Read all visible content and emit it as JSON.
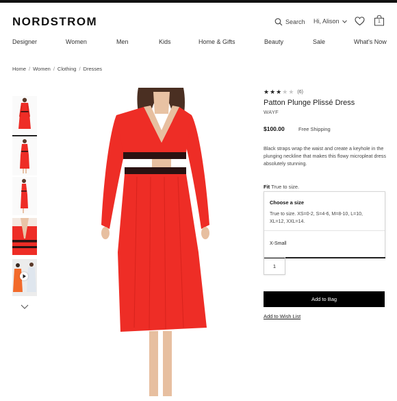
{
  "header": {
    "logo": "NORDSTROM",
    "search_label": "Search",
    "account_label": "Hi, Alison",
    "bag_count": "1"
  },
  "nav": {
    "items": [
      "Designer",
      "Women",
      "Men",
      "Kids",
      "Home & Gifts",
      "Beauty",
      "Sale",
      "What's Now"
    ]
  },
  "breadcrumb": [
    "Home",
    "Women",
    "Clothing",
    "Dresses"
  ],
  "product": {
    "rating": 3,
    "rating_max": 5,
    "review_count": "(6)",
    "title": "Patton Plunge Plissé Dress",
    "brand": "WAYF",
    "price": "$100.00",
    "shipping": "Free Shipping",
    "description": "Black straps wrap the waist and create a keyhole in the plunging neckline that makes this flowy micropleat dress absolutely stunning.",
    "fit_label": "Fit",
    "fit_value": "True to size."
  },
  "size_selector": {
    "heading": "Choose a size",
    "info": "True to size. XS=0-2, S=4-6, M=8-10, L=10, XL=12, XXL=14.",
    "selected": "X-Small"
  },
  "quantity": "1",
  "actions": {
    "add_to_bag": "Add to Bag",
    "wish_list": "Add to Wish List"
  },
  "colors": {
    "dress_red": "#ee2d26",
    "band_black": "#2a1212",
    "button_black": "#000000"
  }
}
